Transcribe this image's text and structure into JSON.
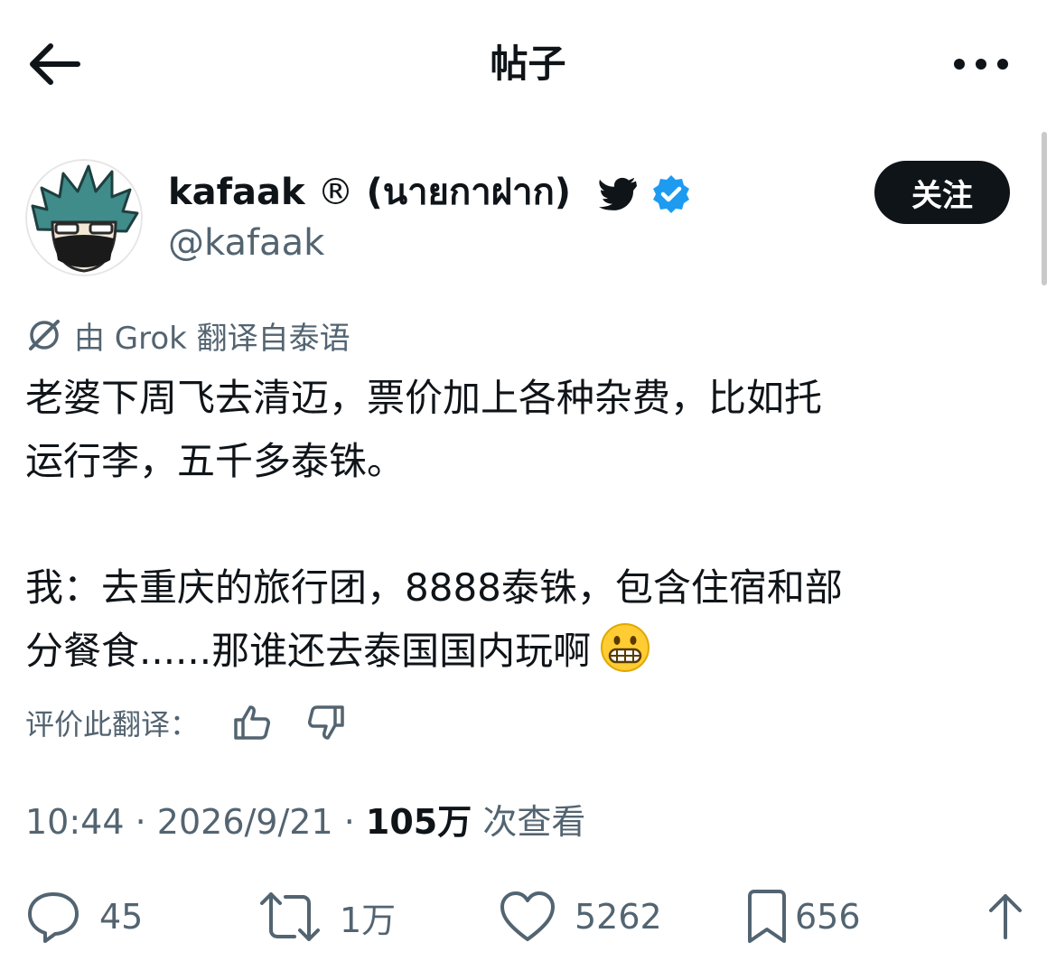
{
  "header": {
    "title": "帖子",
    "back_icon": "arrow-left-icon",
    "more_icon": "more-horizontal-icon"
  },
  "author": {
    "name": "kafaak",
    "registered_mark": "®",
    "name_suffix": "(นายกาฝาก)",
    "handle": "@kafaak",
    "follow_label": "关注",
    "verified_color": "#1d9bf0"
  },
  "translation_note": "由 Grok 翻译自泰语",
  "post": {
    "lines": [
      "老婆下周飞去清迈，票价加上各种杂费，比如托",
      "运行李，五千多泰铢。",
      "我：去重庆的旅行团，8888泰铢，包含住宿和部",
      "分餐食......那谁还去泰国国内玩啊"
    ],
    "emoji": "grimacing-face"
  },
  "rate": {
    "label": "评价此翻译："
  },
  "meta": {
    "time": "10:44",
    "sep": "·",
    "date": "2026/9/21",
    "views": "105万",
    "views_label": "次查看"
  },
  "actions": {
    "replies": "45",
    "reposts": "1万",
    "likes": "5262",
    "bookmarks": "656"
  }
}
